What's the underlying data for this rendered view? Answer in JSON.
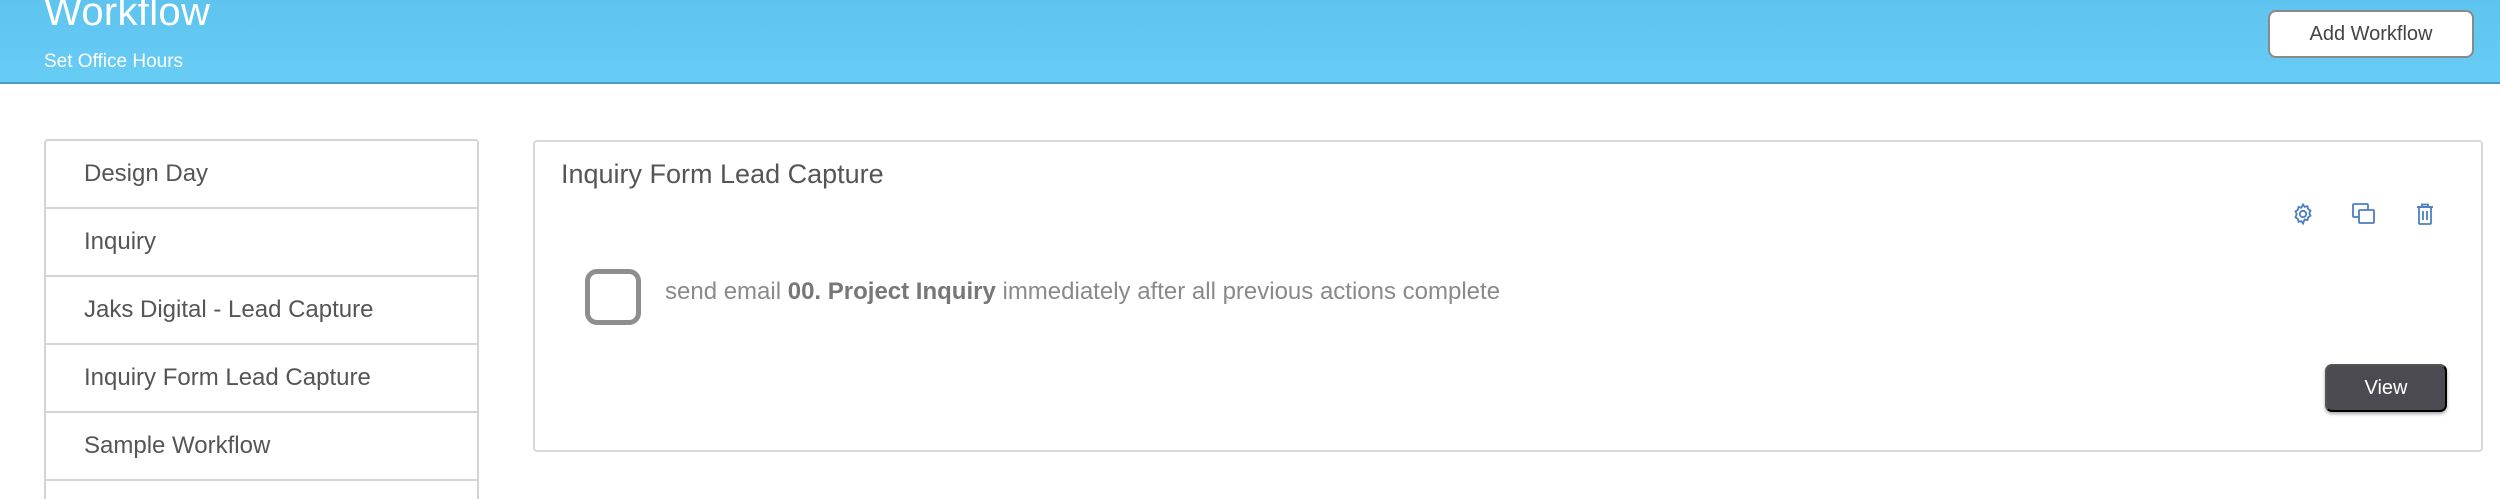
{
  "header": {
    "title": "Workflow",
    "subtitle": "Set Office Hours",
    "add_button_label": "Add Workflow"
  },
  "sidebar": {
    "items": [
      {
        "label": "Design Day"
      },
      {
        "label": "Inquiry"
      },
      {
        "label": "Jaks Digital - Lead Capture"
      },
      {
        "label": "Inquiry Form Lead Capture"
      },
      {
        "label": "Sample Workflow"
      }
    ]
  },
  "main": {
    "card_title": "Inquiry Form Lead Capture",
    "toolbar_icons": [
      "gear-icon",
      "duplicate-icon",
      "trash-icon"
    ],
    "action": {
      "prefix": "send email",
      "email_name": "00. Project Inquiry",
      "suffix": "immediately after all previous actions complete",
      "checked": false
    },
    "view_button_label": "View"
  },
  "colors": {
    "header_bg": "#5ec4ef",
    "icon_blue": "#4b7fbf",
    "view_button_bg": "#4a4a50"
  }
}
